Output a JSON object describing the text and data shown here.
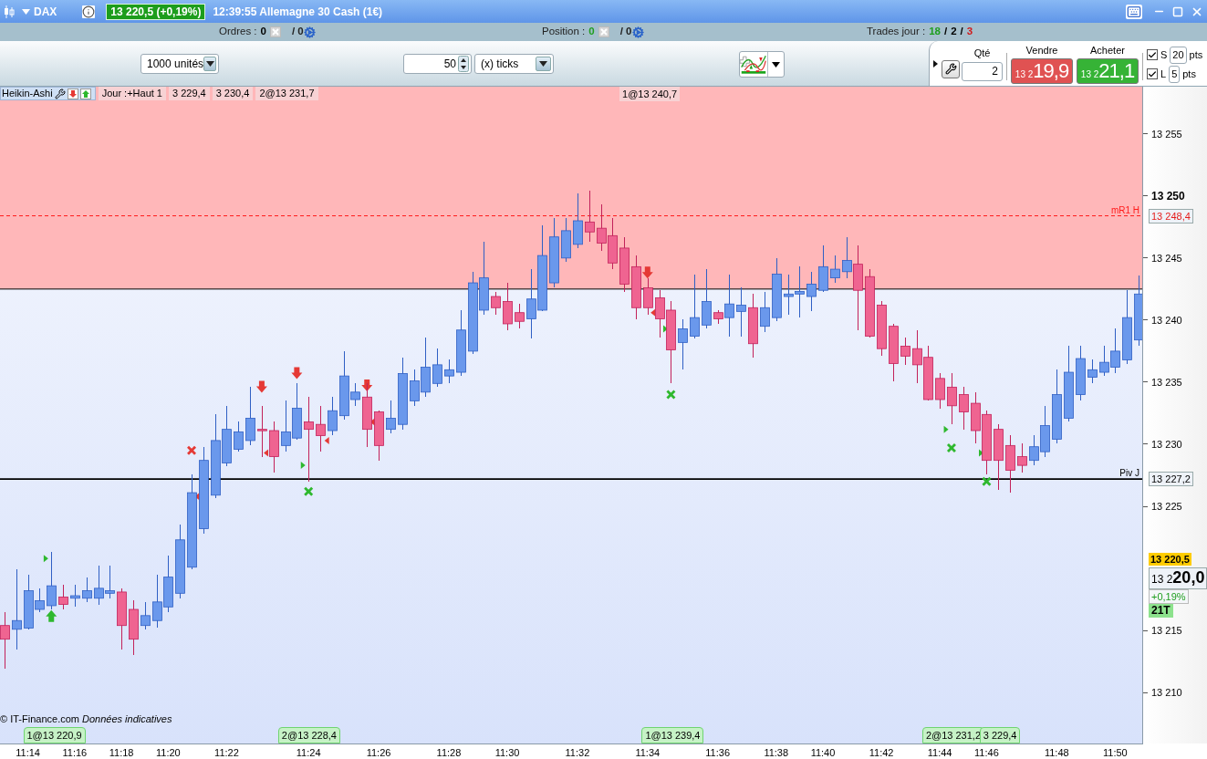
{
  "window": {
    "symbol": "DAX",
    "quote": "13 220,5 (+0,19%)",
    "title": "12:39:55 Allemagne 30 Cash (1€)"
  },
  "status_bar": {
    "items": [
      {
        "kind": "orders",
        "label": "Ordres :",
        "value": "0",
        "total": "/ 0"
      },
      {
        "kind": "position",
        "label": "Position :",
        "value": "0",
        "total": "/ 0"
      }
    ],
    "trades": {
      "label": "Trades jour :",
      "counts": [
        {
          "kind": "won",
          "text": "18"
        },
        {
          "kind": "sep",
          "text": "/"
        },
        {
          "kind": "neutral",
          "text": "2"
        },
        {
          "kind": "sep",
          "text": "/"
        },
        {
          "kind": "lost",
          "text": "3"
        }
      ]
    }
  },
  "toolbar": {
    "units": "1000 unités",
    "step": "50",
    "step_unit": "(x) ticks"
  },
  "order_panel": {
    "qty_label": "Qté",
    "qty": "2",
    "sell": {
      "label": "Vendre",
      "prefix": "13 2",
      "price": "19,9"
    },
    "buy": {
      "label": "Acheter",
      "prefix": "13 2",
      "price": "21,1"
    },
    "stops": [
      {
        "label": "S",
        "value": "20",
        "unit": "pts",
        "checked": true
      },
      {
        "label": "L",
        "value": "5",
        "unit": "pts",
        "checked": true
      }
    ]
  },
  "chart": {
    "indicator": "Heikin-Ashi",
    "header_labels": [
      "Jour :+Haut 1",
      "3 229,4",
      "3 230,4",
      "2@13 231,7"
    ],
    "trade_labels_top": [
      "1@13 240,7"
    ],
    "trade_labels_bottom": [
      "1@13 220,9",
      "2@13 228,4",
      "1@13 239,4",
      "2@13 231,2",
      "3 229,4"
    ],
    "copyright": "© IT-Finance.com *Données indicatives*",
    "price_tags": [
      {
        "kind": "level",
        "text": "13 248,4"
      },
      {
        "kind": "pivot",
        "text": "13 227,2"
      },
      {
        "kind": "last",
        "text": "13 220,5"
      },
      {
        "kind": "bid",
        "prefix": "13 2",
        "text": "20,0"
      },
      {
        "kind": "change",
        "text": "+0,19%"
      },
      {
        "kind": "ticks",
        "text": "21T"
      }
    ],
    "chart_data": {
      "type": "candlestick",
      "ylim": [
        13205.9,
        13258.8
      ],
      "yticks": [
        {
          "value": 13210,
          "label": "13 210"
        },
        {
          "value": 13215,
          "label": "13 215"
        },
        {
          "value": 13225,
          "label": "13 225"
        },
        {
          "value": 13230,
          "label": "13 230"
        },
        {
          "value": 13235,
          "label": "13 235"
        },
        {
          "value": 13240,
          "label": "13 240"
        },
        {
          "value": 13245,
          "label": "13 245"
        },
        {
          "value": 13250,
          "label": "13 250"
        },
        {
          "value": 13255,
          "label": "13 255"
        }
      ],
      "categories": [
        null,
        null,
        "11:14",
        null,
        null,
        null,
        "11:16",
        null,
        null,
        null,
        "11:18",
        null,
        null,
        null,
        "11:20",
        null,
        null,
        null,
        null,
        "11:22",
        null,
        null,
        null,
        null,
        null,
        null,
        "11:24",
        null,
        null,
        null,
        null,
        null,
        "11:26",
        null,
        null,
        null,
        null,
        null,
        "11:28",
        null,
        null,
        null,
        null,
        "11:30",
        null,
        null,
        null,
        null,
        null,
        "11:32",
        null,
        null,
        null,
        null,
        null,
        "11:34",
        null,
        null,
        null,
        null,
        null,
        "11:36",
        null,
        null,
        null,
        null,
        "11:38",
        null,
        null,
        null,
        "11:40",
        null,
        null,
        null,
        null,
        "11:42",
        null,
        null,
        null,
        null,
        "11:44",
        null,
        null,
        null,
        "11:46",
        null,
        null,
        null,
        null,
        null,
        "11:48",
        null,
        null,
        null,
        null,
        "11:50",
        null,
        null
      ],
      "ohlc": [
        [
          13215.4,
          13216.5,
          13211.9,
          13214.3
        ],
        [
          13215.1,
          13219.9,
          13213.5,
          13215.8
        ],
        [
          13215.2,
          13219.5,
          13215.1,
          13218.2
        ],
        [
          13216.7,
          13218.4,
          13216.5,
          13217.4
        ],
        [
          13217.0,
          13221.3,
          13216.7,
          13218.6
        ],
        [
          13217.7,
          13218.7,
          13216.7,
          13217.1
        ],
        [
          13217.6,
          13218.7,
          13216.9,
          13217.8
        ],
        [
          13217.6,
          13219.3,
          13217.3,
          13218.2
        ],
        [
          13217.6,
          13220.2,
          13217.1,
          13218.4
        ],
        [
          13218.0,
          13220.2,
          13217.6,
          13218.2
        ],
        [
          13218.1,
          13218.4,
          13213.5,
          13215.4
        ],
        [
          13216.7,
          13217.4,
          13213.0,
          13214.3
        ],
        [
          13215.4,
          13217.3,
          13215.1,
          13216.2
        ],
        [
          13215.8,
          13219.5,
          13215.2,
          13217.3
        ],
        [
          13216.9,
          13221.0,
          13216.5,
          13219.3
        ],
        [
          13218.0,
          13223.5,
          13217.6,
          13222.3
        ],
        [
          13220.1,
          13227.6,
          13219.9,
          13226.1
        ],
        [
          13223.2,
          13229.8,
          13222.8,
          13228.7
        ],
        [
          13225.9,
          13232.4,
          13225.7,
          13230.3
        ],
        [
          13228.5,
          13233.1,
          13228.2,
          13231.2
        ],
        [
          13229.6,
          13231.8,
          13229.4,
          13231.0
        ],
        [
          13230.3,
          13234.6,
          13229.9,
          13232.1
        ],
        [
          13231.2,
          13233.1,
          13229.0,
          13231.2
        ],
        [
          13231.1,
          13231.8,
          13227.7,
          13229.0
        ],
        [
          13229.9,
          13233.5,
          13229.4,
          13231.0
        ],
        [
          13230.5,
          13234.9,
          13230.4,
          13232.9
        ],
        [
          13231.8,
          13233.8,
          13227.0,
          13231.2
        ],
        [
          13231.6,
          13233.1,
          13229.4,
          13230.7
        ],
        [
          13231.1,
          13233.8,
          13230.7,
          13232.7
        ],
        [
          13232.3,
          13237.5,
          13232.0,
          13235.5
        ],
        [
          13233.6,
          13234.9,
          13233.1,
          13234.2
        ],
        [
          13233.8,
          13234.9,
          13229.8,
          13231.2
        ],
        [
          13232.6,
          13232.7,
          13228.7,
          13229.9
        ],
        [
          13231.2,
          13233.5,
          13230.9,
          13232.1
        ],
        [
          13231.6,
          13237.0,
          13231.2,
          13235.7
        ],
        [
          13233.5,
          13236.0,
          13233.1,
          13235.1
        ],
        [
          13234.2,
          13238.6,
          13233.8,
          13236.2
        ],
        [
          13234.9,
          13237.7,
          13234.6,
          13236.4
        ],
        [
          13235.5,
          13236.8,
          13234.9,
          13236.0
        ],
        [
          13235.8,
          13240.8,
          13235.5,
          13239.2
        ],
        [
          13237.5,
          13243.9,
          13237.3,
          13243.0
        ],
        [
          13240.8,
          13246.3,
          13240.4,
          13243.4
        ],
        [
          13241.9,
          13242.3,
          13240.4,
          13241.0
        ],
        [
          13241.5,
          13243.0,
          13239.2,
          13239.7
        ],
        [
          13240.6,
          13241.3,
          13239.3,
          13239.9
        ],
        [
          13240.1,
          13244.1,
          13238.5,
          13241.7
        ],
        [
          13240.8,
          13247.6,
          13240.7,
          13245.2
        ],
        [
          13243.0,
          13248.2,
          13242.6,
          13246.7
        ],
        [
          13245.0,
          13248.2,
          13244.7,
          13247.2
        ],
        [
          13246.1,
          13250.2,
          13245.8,
          13248.0
        ],
        [
          13247.9,
          13250.4,
          13246.3,
          13247.1
        ],
        [
          13247.4,
          13249.3,
          13245.6,
          13246.2
        ],
        [
          13246.8,
          13248.2,
          13244.1,
          13244.6
        ],
        [
          13245.8,
          13246.7,
          13242.3,
          13242.9
        ],
        [
          13244.3,
          13245.2,
          13240.1,
          13241.0
        ],
        [
          13242.6,
          13243.4,
          13240.4,
          13241.0
        ],
        [
          13241.8,
          13242.4,
          13238.6,
          13240.1
        ],
        [
          13240.8,
          13241.5,
          13234.9,
          13237.6
        ],
        [
          13238.2,
          13240.1,
          13236.0,
          13239.3
        ],
        [
          13238.7,
          13243.7,
          13238.5,
          13240.2
        ],
        [
          13239.6,
          13244.1,
          13239.3,
          13241.5
        ],
        [
          13240.6,
          13240.8,
          13239.7,
          13240.1
        ],
        [
          13240.2,
          13243.7,
          13238.7,
          13241.3
        ],
        [
          13240.7,
          13242.6,
          13238.7,
          13241.2
        ],
        [
          13241.0,
          13242.1,
          13237.0,
          13238.1
        ],
        [
          13239.5,
          13242.3,
          13239.0,
          13241.0
        ],
        [
          13240.2,
          13245.0,
          13239.9,
          13243.7
        ],
        [
          13241.9,
          13243.7,
          13240.4,
          13242.1
        ],
        [
          13242.1,
          13244.3,
          13240.2,
          13242.3
        ],
        [
          13241.9,
          13243.9,
          13240.7,
          13242.9
        ],
        [
          13242.4,
          13246.0,
          13242.3,
          13244.3
        ],
        [
          13243.4,
          13245.2,
          13243.0,
          13244.1
        ],
        [
          13243.9,
          13246.7,
          13243.4,
          13244.8
        ],
        [
          13244.5,
          13246.0,
          13239.2,
          13242.4
        ],
        [
          13243.5,
          13244.1,
          13238.6,
          13238.7
        ],
        [
          13241.2,
          13241.5,
          13237.1,
          13237.7
        ],
        [
          13239.5,
          13239.7,
          13235.1,
          13236.5
        ],
        [
          13237.9,
          13238.6,
          13236.4,
          13237.1
        ],
        [
          13237.7,
          13239.2,
          13234.9,
          13236.4
        ],
        [
          13237.0,
          13237.9,
          13233.5,
          13233.6
        ],
        [
          13235.3,
          13235.7,
          13232.9,
          13233.6
        ],
        [
          13234.6,
          13235.7,
          13231.6,
          13233.1
        ],
        [
          13234.0,
          13234.6,
          13231.2,
          13232.6
        ],
        [
          13233.3,
          13234.2,
          13230.1,
          13231.1
        ],
        [
          13232.4,
          13232.7,
          13227.6,
          13228.7
        ],
        [
          13231.2,
          13231.6,
          13226.3,
          13228.7
        ],
        [
          13229.9,
          13230.7,
          13226.1,
          13227.9
        ],
        [
          13229.0,
          13230.1,
          13227.7,
          13228.3
        ],
        [
          13228.7,
          13230.7,
          13228.3,
          13229.8
        ],
        [
          13229.4,
          13233.1,
          13229.0,
          13231.5
        ],
        [
          13230.4,
          13236.0,
          13230.1,
          13234.0
        ],
        [
          13232.1,
          13237.9,
          13231.8,
          13235.8
        ],
        [
          13234.0,
          13237.9,
          13233.5,
          13236.9
        ],
        [
          13235.4,
          13236.8,
          13234.9,
          13236.0
        ],
        [
          13235.8,
          13237.9,
          13235.5,
          13236.6
        ],
        [
          13236.2,
          13239.3,
          13235.7,
          13237.5
        ],
        [
          13236.8,
          13242.4,
          13236.5,
          13240.2
        ],
        [
          13238.4,
          13243.6,
          13237.9,
          13242.1
        ]
      ],
      "ref_lines": [
        {
          "axis": "y",
          "value": 13248.4,
          "label": "mR1 H"
        },
        {
          "axis": "y",
          "value": 13227.2,
          "label": "Piv J"
        },
        {
          "axis": "y",
          "value": 13242.5
        }
      ],
      "bands": [
        {
          "axis": "y",
          "from": 13242.5,
          "to": 13258.8
        }
      ]
    }
  }
}
